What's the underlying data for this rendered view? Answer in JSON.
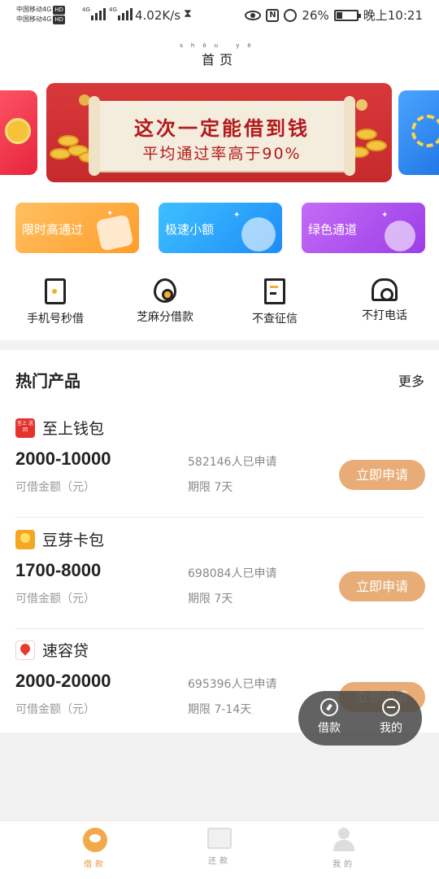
{
  "status_bar": {
    "carrier_line1": "中国移动4G",
    "carrier_line2": "中国移动4G",
    "hd_badge": "HD",
    "network_tag": "4G",
    "speed": "4.02K/s",
    "battery": "26%",
    "battery_level": 0.26,
    "time": "晚上10:21",
    "icons": [
      "hourglass-icon",
      "eye-icon",
      "nfc-icon",
      "alarm-icon",
      "battery-icon"
    ]
  },
  "header": {
    "title": "首页",
    "title_pinyin": "shǒu yè"
  },
  "banner": {
    "headline": "这次一定能借到钱",
    "subline": "平均通过率高于90%",
    "accent_color": "#c52a2d"
  },
  "categories": [
    {
      "label": "限时高通过",
      "color": "#ffae44"
    },
    {
      "label": "极速小额",
      "color": "#2aa6fb"
    },
    {
      "label": "绿色通道",
      "color": "#b056ef"
    }
  ],
  "quick_links": [
    {
      "label": "手机号秒借",
      "icon": "phone-icon"
    },
    {
      "label": "芝麻分借款",
      "icon": "sesame-icon"
    },
    {
      "label": "不查征信",
      "icon": "document-icon"
    },
    {
      "label": "不打电话",
      "icon": "telephone-icon"
    }
  ],
  "hot_products": {
    "title": "热门产品",
    "more": "更多",
    "amount_label": "可借金额（元）",
    "apply_label": "立即申请",
    "items": [
      {
        "name": "至上钱包",
        "logo_text": "至上 送回",
        "amount": "2000-10000",
        "applicants": "582146人已申请",
        "term": "期限 7天"
      },
      {
        "name": "豆芽卡包",
        "amount": "1700-8000",
        "applicants": "698084人已申请",
        "term": "期限 7天"
      },
      {
        "name": "速容贷",
        "amount": "2000-20000",
        "applicants": "695396人已申请",
        "term": "期限 7-14天"
      }
    ]
  },
  "float_menu": {
    "borrow": "借款",
    "mine": "我的"
  },
  "bottom_nav": {
    "borrow": "借款",
    "repay": "还款",
    "mine": "我的",
    "active_color": "#e89a3c"
  }
}
